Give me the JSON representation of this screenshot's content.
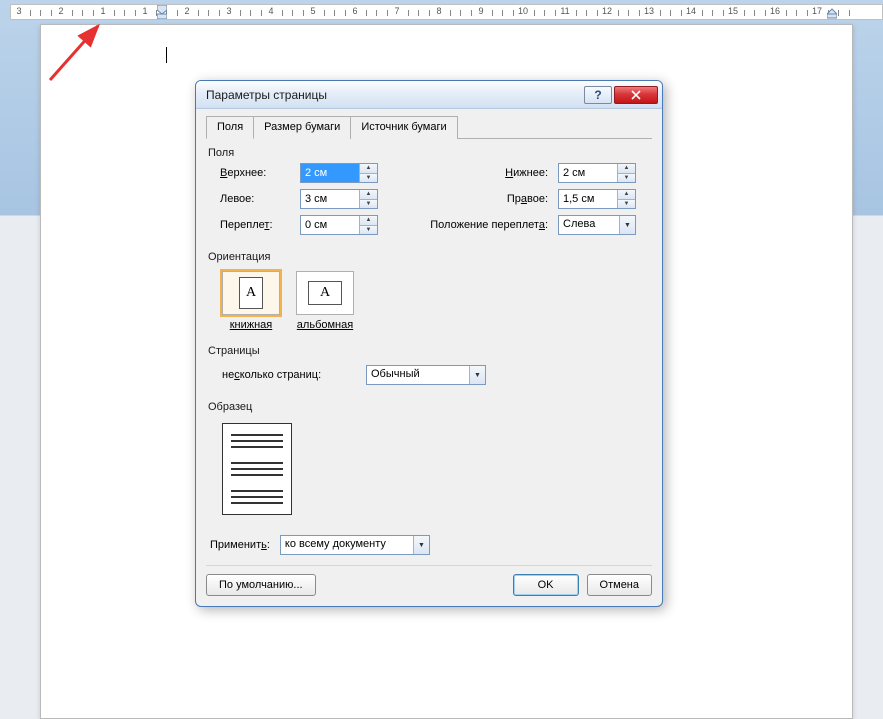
{
  "ruler": {
    "numbers": [
      "3",
      "2",
      "1",
      "1",
      "2",
      "3",
      "4",
      "5",
      "6",
      "7",
      "8",
      "9",
      "10",
      "11",
      "12",
      "13",
      "14",
      "15",
      "16",
      "17"
    ]
  },
  "dialog": {
    "title": "Параметры страницы",
    "tabs": {
      "margins": "Поля",
      "paper_size": "Размер бумаги",
      "paper_source": "Источник бумаги"
    },
    "sections": {
      "margins": "Поля",
      "orientation": "Ориентация",
      "pages": "Страницы",
      "preview": "Образец"
    },
    "margins": {
      "top_label": "Верхнее:",
      "top_value": "2 см",
      "bottom_label": "Нижнее:",
      "bottom_value": "2 см",
      "left_label": "Левое:",
      "left_value": "3 см",
      "right_label": "Правое:",
      "right_value": "1,5 см",
      "gutter_label": "Переплет:",
      "gutter_value": "0 см",
      "gutter_pos_label": "Положение переплета:",
      "gutter_pos_value": "Слева"
    },
    "orientation": {
      "portrait": "книжная",
      "landscape": "альбомная"
    },
    "pages": {
      "multiple_label": "несколько страниц:",
      "multiple_value": "Обычный"
    },
    "apply": {
      "label": "Применить:",
      "value": "ко всему документу"
    },
    "buttons": {
      "default": "По умолчанию...",
      "ok": "OK",
      "cancel": "Отмена"
    }
  }
}
